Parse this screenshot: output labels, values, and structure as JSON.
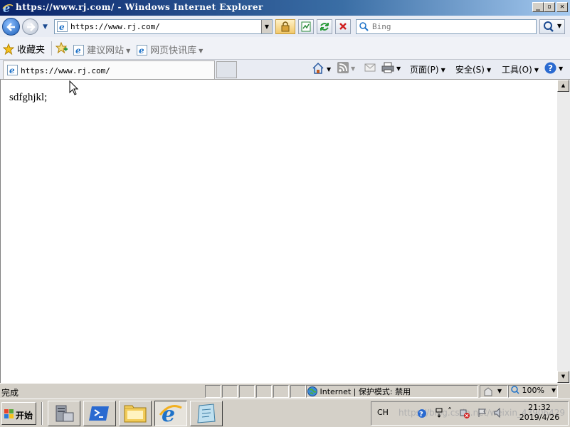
{
  "window": {
    "title": "https://www.rj.com/ - Windows Internet Explorer"
  },
  "nav": {
    "address_url": "https://www.rj.com/",
    "search_placeholder": "Bing"
  },
  "favorites_bar": {
    "favorites_label": "收藏夹",
    "suggested_sites_label": "建议网站",
    "web_slice_label": "网页快讯库"
  },
  "tabs": [
    {
      "label": "https://www.rj.com/"
    }
  ],
  "command_bar": {
    "page_label": "页面(P)",
    "safety_label": "安全(S)",
    "tools_label": "工具(O)"
  },
  "content": {
    "text": "sdfghjkl;"
  },
  "status_bar": {
    "status_text": "完成",
    "zone_label": "Internet | 保护模式: 禁用",
    "zoom_label": "100%"
  },
  "taskbar": {
    "start_label": "开始",
    "language": "CH",
    "clock_time": "21:32",
    "clock_date": "2019/4/26",
    "watermark": "https://blog.csdn.net/weixin_43906429"
  },
  "colors": {
    "titlebar": "#0a246a",
    "ie_blue": "#1e72c8",
    "content_bg": "#ffffff"
  }
}
